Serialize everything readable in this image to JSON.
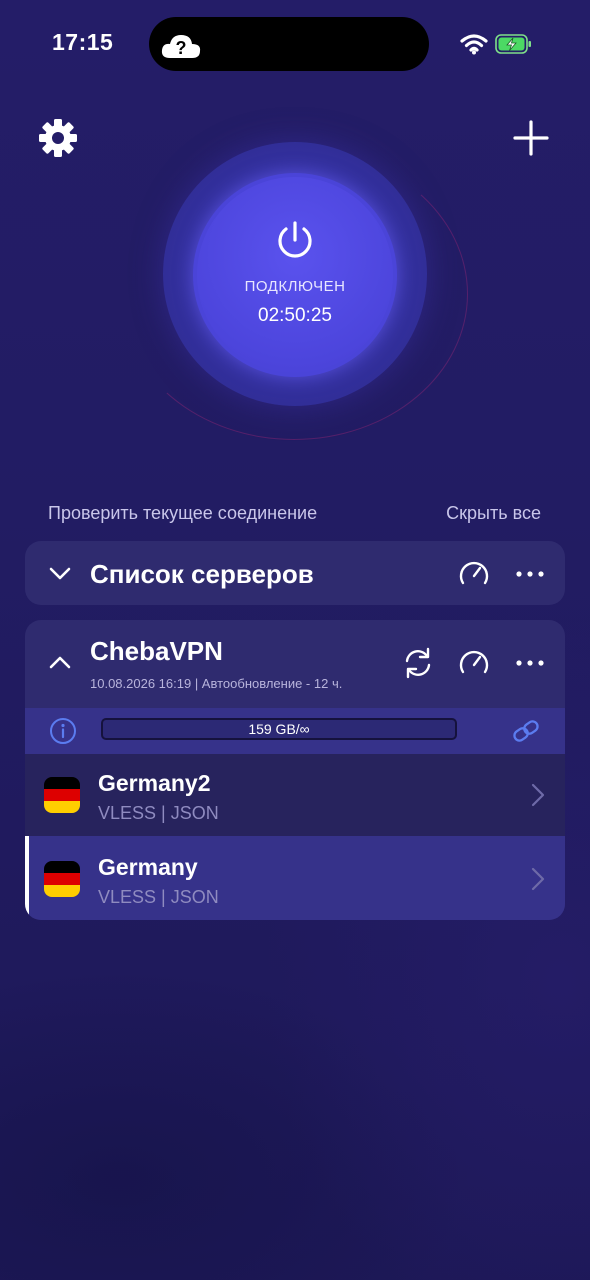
{
  "status_bar": {
    "time": "17:15"
  },
  "power": {
    "status": "ПОДКЛЮЧЕН",
    "timer": "02:50:25"
  },
  "links": {
    "check_connection": "Проверить текущее соединение",
    "hide_all": "Скрыть все"
  },
  "server_list": {
    "title": "Список серверов"
  },
  "subscription": {
    "name": "ChebaVPN",
    "info": "10.08.2026 16:19 | Автообновление - 12 ч.",
    "traffic": "159 GB/∞",
    "servers": [
      {
        "name": "Germany2",
        "protocol": "VLESS | JSON",
        "selected": false
      },
      {
        "name": "Germany",
        "protocol": "VLESS | JSON",
        "selected": true
      }
    ]
  },
  "colors": {
    "accent": "#4c45dc",
    "card": "#2f2b6f",
    "background": "#221c63"
  }
}
